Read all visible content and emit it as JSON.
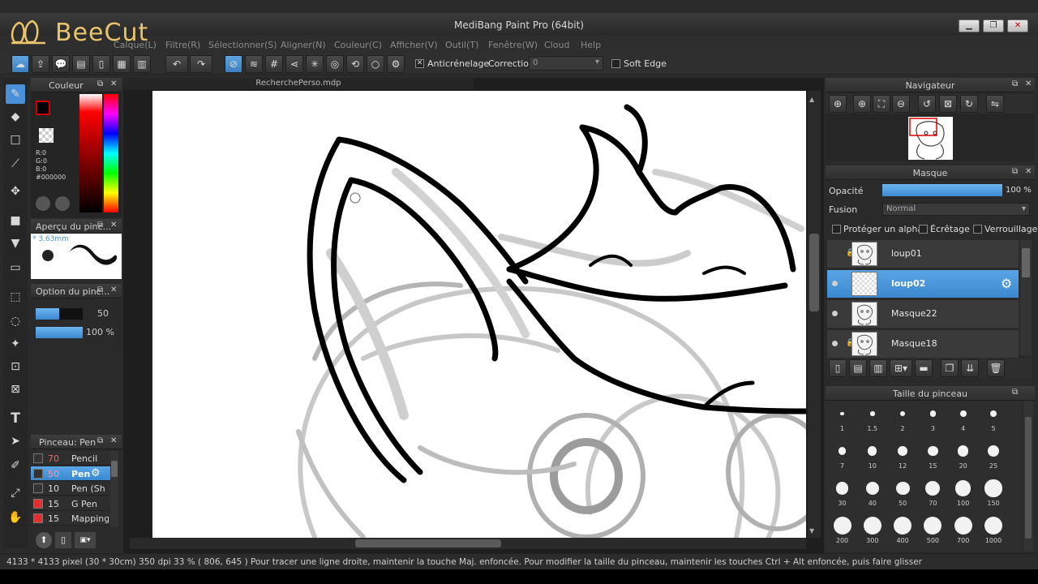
{
  "window": {
    "title": "MediBang Paint Pro (64bit)"
  },
  "watermark": {
    "text": "BeeCut"
  },
  "menu": [
    "Calque(L)",
    "Filtre(R)",
    "Sélectionner(S)",
    "Aligner(N)",
    "Couleur(C)",
    "Afficher(V)",
    "Outil(T)",
    "Fenêtre(W)",
    "Cloud",
    "Help"
  ],
  "toolbar": {
    "antialias_label": "Anticrénelage",
    "correction_label": "Correction",
    "correction_value": "0",
    "soft_edge_label": "Soft Edge"
  },
  "color_panel": {
    "title": "Couleur",
    "r": "R:0",
    "g": "G:0",
    "b": "B:0",
    "hex": "#000000",
    "primary": "#000000"
  },
  "brush_preview": {
    "title": "Aperçu du pinc...",
    "size_label": "* 3.63mm"
  },
  "brush_option": {
    "title": "Option du pinc...",
    "size_value": "50",
    "opacity_value": "100 %",
    "size_fraction": 0.5,
    "opacity_fraction": 1.0
  },
  "brush_list": {
    "title": "Pinceau: Pen",
    "items": [
      {
        "size": "70",
        "name": "Pencil",
        "color": "#333333",
        "selected": false
      },
      {
        "size": "50",
        "name": "Pen",
        "color": "#333333",
        "selected": true
      },
      {
        "size": "10",
        "name": "Pen (Sh",
        "color": "#333333",
        "selected": false
      },
      {
        "size": "15",
        "name": "G Pen",
        "color": "#e03030",
        "selected": false
      },
      {
        "size": "15",
        "name": "Mapping",
        "color": "#e03030",
        "selected": false
      }
    ]
  },
  "document": {
    "tab": "RecherchePerso.mdp"
  },
  "navigator": {
    "title": "Navigateur"
  },
  "layer_panel": {
    "title": "Masque",
    "opacity_label": "Opacité",
    "opacity_value": "100 %",
    "opacity_fraction": 1.0,
    "blend_label": "Fusion",
    "blend_value": "Normal",
    "protect_alpha": "Protéger un alpha",
    "clipping": "Écrêtage",
    "lock": "Verrouillage",
    "layers": [
      {
        "name": "loup01",
        "selected": false,
        "locked": true,
        "visible": false
      },
      {
        "name": "loup02",
        "selected": true,
        "locked": false,
        "visible": true
      },
      {
        "name": "Masque22",
        "selected": false,
        "locked": false,
        "visible": true
      },
      {
        "name": "Masque18",
        "selected": false,
        "locked": true,
        "visible": true
      }
    ]
  },
  "brush_size_panel": {
    "title": "Taille du pinceau",
    "sizes": [
      "1",
      "1.5",
      "2",
      "3",
      "4",
      "5",
      "7",
      "10",
      "12",
      "15",
      "20",
      "25",
      "30",
      "40",
      "50",
      "70",
      "100",
      "150",
      "200",
      "300",
      "400",
      "500",
      "700",
      "1000"
    ]
  },
  "status": {
    "text": "4133 * 4133 pixel   (30 * 30cm)  350 dpi   33 %   ( 806, 645 )   Pour tracer une ligne droite, maintenir la touche Maj. enfoncée. Pour modifier la taille du pinceau, maintenir les touches Ctrl + Alt enfoncée, puis faire glisser"
  }
}
